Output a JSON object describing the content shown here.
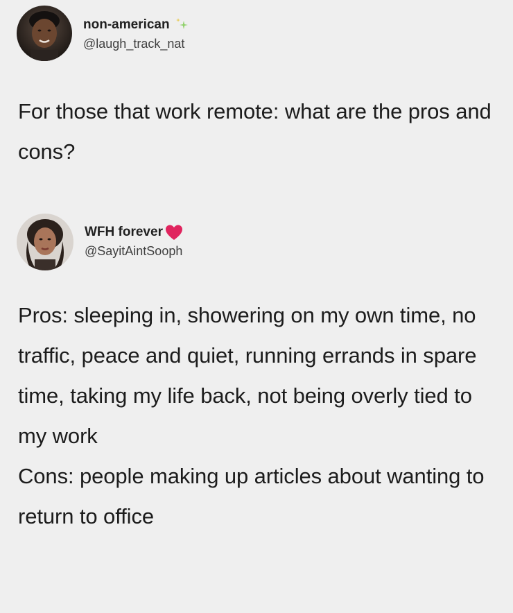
{
  "posts": [
    {
      "display_name": "non-american",
      "handle": "@laugh_track_nat",
      "badge_icon": "sparkle-icon",
      "text": "For those that work remote: what are the pros and cons?"
    },
    {
      "display_name": "WFH forever",
      "handle": "@SayitAintSooph",
      "badge_icon": "heart-icon",
      "paragraphs": [
        "Pros: sleeping in, showering on my own time, no traffic, peace and quiet, running errands in spare time, taking my life back, not being overly tied to my work",
        "Cons: people making up articles about wanting to return to office"
      ]
    }
  ],
  "colors": {
    "background": "#efefef",
    "heart": "#e0245e",
    "sparkle": "#8fd16a"
  }
}
